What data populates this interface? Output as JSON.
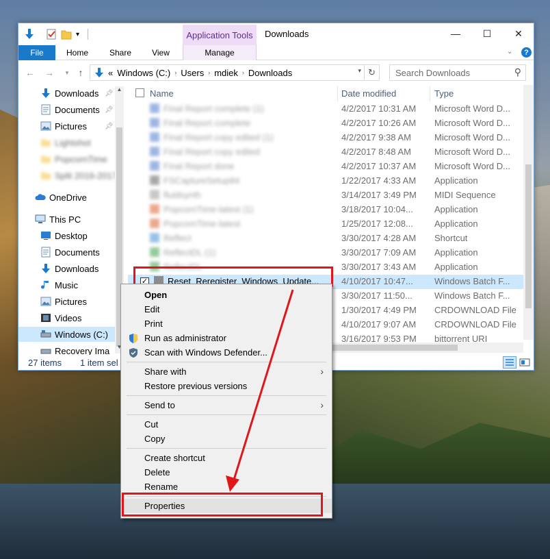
{
  "window": {
    "title": "Downloads",
    "context_tab_title": "Application Tools",
    "ribbon_tabs": [
      "File",
      "Home",
      "Share",
      "View",
      "Manage"
    ],
    "help": "?"
  },
  "address": {
    "overflow": "«",
    "segments": [
      "Windows (C:)",
      "Users",
      "mdiek",
      "Downloads"
    ],
    "search_placeholder": "Search Downloads"
  },
  "nav": {
    "quick_access": [
      {
        "label": "Downloads",
        "pinned": true
      },
      {
        "label": "Documents",
        "pinned": true
      },
      {
        "label": "Pictures",
        "pinned": true
      },
      {
        "label": "Lightshot",
        "pinned": true
      },
      {
        "label": "PopcornTime",
        "pinned": false
      },
      {
        "label": "Split 2016-2017",
        "pinned": false
      }
    ],
    "onedrive": "OneDrive",
    "this_pc": "This PC",
    "pc_items": [
      "Desktop",
      "Documents",
      "Downloads",
      "Music",
      "Pictures",
      "Videos",
      "Windows (C:)",
      "Recovery Ima"
    ]
  },
  "columns": {
    "name": "Name",
    "date": "Date modified",
    "type": "Type"
  },
  "files": [
    {
      "name": "Final Report complete (1)",
      "date": "4/2/2017 10:31 AM",
      "type": "Microsoft Word D...",
      "blurred": true,
      "color": "#6b8fd4"
    },
    {
      "name": "Final Report complete",
      "date": "4/2/2017 10:26 AM",
      "type": "Microsoft Word D...",
      "blurred": true,
      "color": "#6b8fd4"
    },
    {
      "name": "Final Report copy edited (1)",
      "date": "4/2/2017 9:38 AM",
      "type": "Microsoft Word D...",
      "blurred": true,
      "color": "#6b8fd4"
    },
    {
      "name": "Final Report copy edited",
      "date": "4/2/2017 8:48 AM",
      "type": "Microsoft Word D...",
      "blurred": true,
      "color": "#6b8fd4"
    },
    {
      "name": "Final Report done",
      "date": "4/2/2017 10:37 AM",
      "type": "Microsoft Word D...",
      "blurred": true,
      "color": "#6b8fd4"
    },
    {
      "name": "FSCaptureSetup84",
      "date": "1/22/2017 4:33 AM",
      "type": "Application",
      "blurred": true,
      "color": "#7a7a7a"
    },
    {
      "name": "fluidsynth",
      "date": "3/14/2017 3:49 PM",
      "type": "MIDI Sequence",
      "blurred": true,
      "color": "#aaaaaa"
    },
    {
      "name": "PopcornTime-latest (1)",
      "date": "3/18/2017 10:04...",
      "type": "Application",
      "blurred": true,
      "color": "#e07a50"
    },
    {
      "name": "PopcornTime-latest",
      "date": "1/25/2017 12:08...",
      "type": "Application",
      "blurred": true,
      "color": "#e07a50"
    },
    {
      "name": "Reflect",
      "date": "3/30/2017 4:28 AM",
      "type": "Shortcut",
      "blurred": true,
      "color": "#5fa0d8"
    },
    {
      "name": "ReflectDL (1)",
      "date": "3/30/2017 7:09 AM",
      "type": "Application",
      "blurred": true,
      "color": "#5fb06a"
    },
    {
      "name": "ReflectDL",
      "date": "3/30/2017 3:43 AM",
      "type": "Application",
      "blurred": true,
      "color": "#5fb06a"
    },
    {
      "name": "Reset_Reregister_Windows_Update...",
      "date": "4/10/2017 10:47...",
      "type": "Windows Batch F...",
      "blurred": false,
      "selected": true,
      "color": "#8c8c8c"
    },
    {
      "name": "",
      "date": "3/30/2017 11:50...",
      "type": "Windows Batch F...",
      "blurred": true,
      "color": "#8c8c8c"
    },
    {
      "name": "",
      "date": "1/30/2017 4:49 PM",
      "type": "CRDOWNLOAD File",
      "blurred": true,
      "color": "#cccccc"
    },
    {
      "name": "",
      "date": "4/10/2017 9:07 AM",
      "type": "CRDOWNLOAD File",
      "blurred": true,
      "color": "#cccccc"
    },
    {
      "name": "",
      "date": "3/16/2017 9:53 PM",
      "type": "bittorrent URI",
      "blurred": true,
      "color": "#cccccc"
    }
  ],
  "status": {
    "count": "27 items",
    "selected": "1 item sel"
  },
  "context_menu": {
    "open": "Open",
    "edit": "Edit",
    "print": "Print",
    "run_admin": "Run as administrator",
    "scan": "Scan with Windows Defender...",
    "share_with": "Share with",
    "restore": "Restore previous versions",
    "send_to": "Send to",
    "cut": "Cut",
    "copy": "Copy",
    "create_shortcut": "Create shortcut",
    "delete": "Delete",
    "rename": "Rename",
    "properties": "Properties"
  },
  "colors": {
    "accent": "#1979ca",
    "highlight_red": "#e0161b",
    "selection": "#cce8ff",
    "context_tab": "#eedcf7"
  }
}
